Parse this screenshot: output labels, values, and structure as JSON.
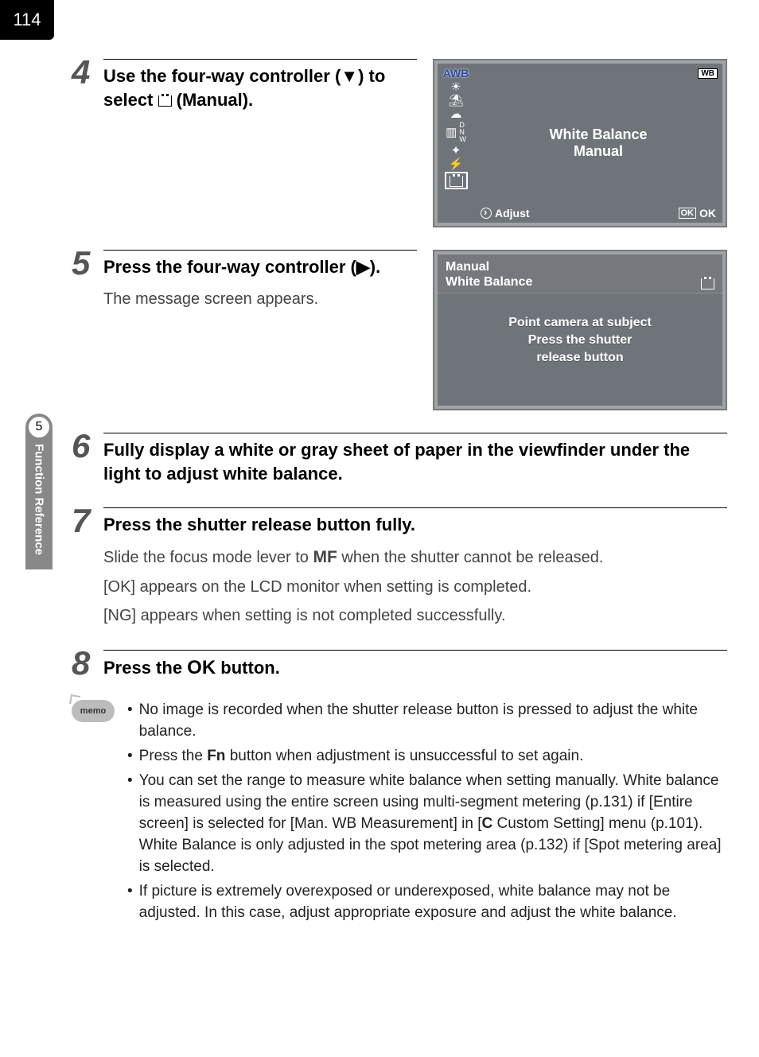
{
  "page_number": "114",
  "side": {
    "section_number": "5",
    "section_label": "Function Reference"
  },
  "steps": {
    "s4": {
      "num": "4",
      "title_a": "Use the four-way controller (",
      "title_b": ") to select ",
      "title_c": " (Manual)."
    },
    "s5": {
      "num": "5",
      "title_a": "Press the four-way controller (",
      "title_b": ").",
      "desc": "The message screen appears."
    },
    "s6": {
      "num": "6",
      "title": "Fully display a white or gray sheet of paper in the viewfinder under the light to adjust white balance."
    },
    "s7": {
      "num": "7",
      "title": "Press the shutter release button fully.",
      "desc_a": "Slide the focus mode lever to ",
      "desc_mf": "MF",
      "desc_b": " when the shutter cannot be released.",
      "desc2": "[OK] appears on the LCD monitor when setting is completed.",
      "desc3": "[NG] appears when setting is not completed successfully."
    },
    "s8": {
      "num": "8",
      "title_a": "Press the ",
      "title_ok": "OK",
      "title_b": " button."
    }
  },
  "lcd1": {
    "awb": "AWB",
    "dnw": [
      "D",
      "N",
      "W"
    ],
    "wb_badge": "WB",
    "heading1": "White Balance",
    "heading2": "Manual",
    "adjust": "Adjust",
    "ok_box": "OK",
    "ok_text": "OK"
  },
  "lcd2": {
    "title1": "Manual",
    "title2": "White Balance",
    "msg1": "Point camera at subject",
    "msg2": "Press the shutter",
    "msg3": "release button"
  },
  "memo": {
    "badge": "memo",
    "items": [
      {
        "text_a": "No image is recorded when the shutter release button is pressed to adjust the white balance."
      },
      {
        "text_a": "Press the ",
        "fn": "Fn",
        "text_b": " button when adjustment is unsuccessful to set again."
      },
      {
        "text_a": "You can set the range to measure white balance when setting manually. White balance is measured using the entire screen using multi-segment metering (p.131) if [Entire screen] is selected for [Man. WB Measurement] in [",
        "c": "C",
        "text_b": " Custom Setting] menu (p.101). White Balance is only adjusted in the spot metering area (p.132) if [Spot metering area] is selected."
      },
      {
        "text_a": "If picture is extremely overexposed or underexposed, white balance may not be adjusted. In this case, adjust appropriate exposure and adjust the white balance."
      }
    ]
  }
}
